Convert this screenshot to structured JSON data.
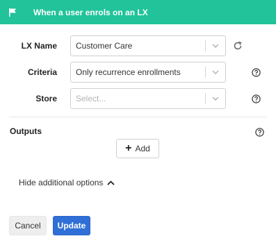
{
  "header": {
    "title": "When a user enrols on an LX",
    "icon": "flag-icon",
    "color": "#22c39a"
  },
  "form": {
    "lx_name": {
      "label": "LX Name",
      "value": "Customer Care"
    },
    "criteria": {
      "label": "Criteria",
      "value": "Only recurrence enrollments"
    },
    "store": {
      "label": "Store",
      "placeholder": "Select..."
    }
  },
  "outputs": {
    "label": "Outputs",
    "add_label": "Add"
  },
  "options_toggle": {
    "label": "Hide additional options"
  },
  "actions": {
    "cancel_label": "Cancel",
    "update_label": "Update",
    "update_color": "#2f6fd6"
  }
}
